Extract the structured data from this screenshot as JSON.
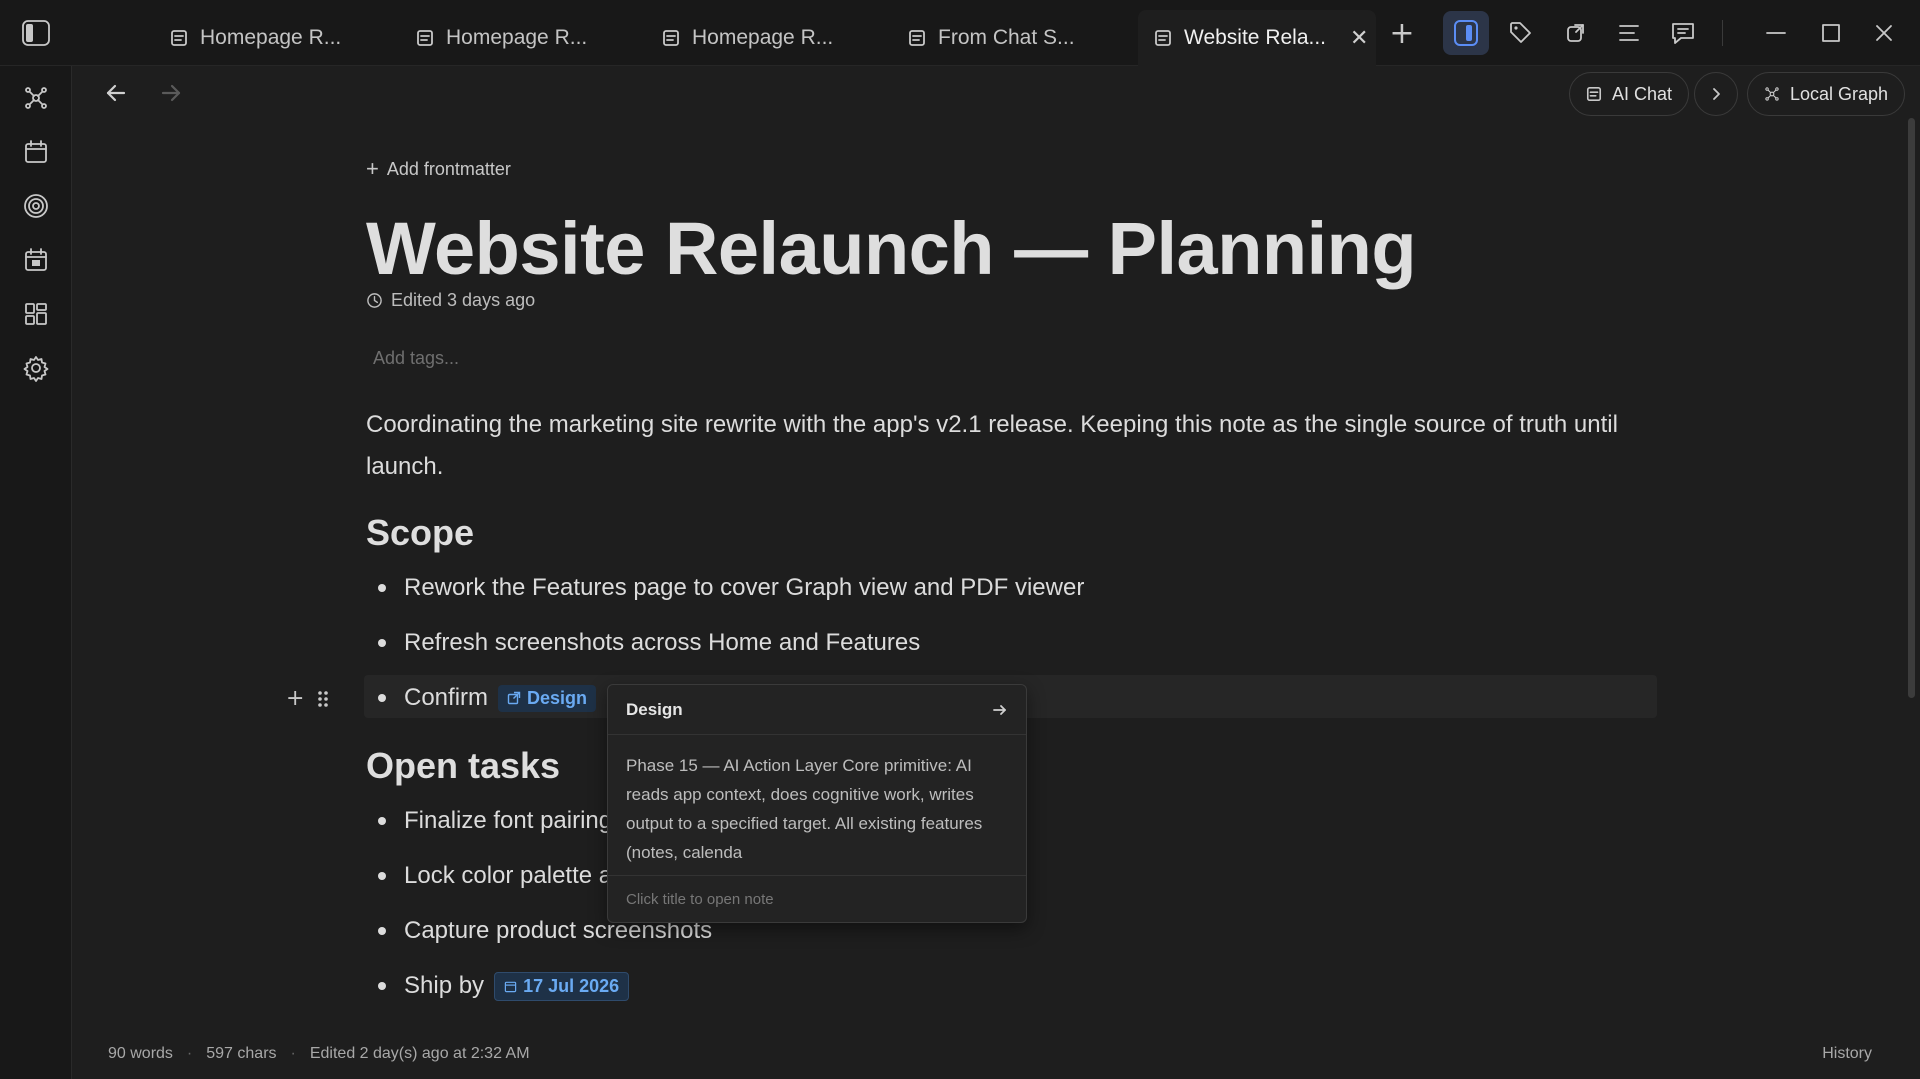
{
  "tabs": [
    {
      "label": "Homepage R...",
      "active": false
    },
    {
      "label": "Homepage R...",
      "active": false
    },
    {
      "label": "Homepage R...",
      "active": false
    },
    {
      "label": "From Chat S...",
      "active": false
    },
    {
      "label": "Website Rela...",
      "active": true
    }
  ],
  "toolbar": {
    "new_tab": "+",
    "icons": [
      "sidebar-toggle-icon",
      "tag-icon",
      "share-icon",
      "outline-icon",
      "comments-icon"
    ],
    "window_controls": [
      "minimize-icon",
      "maximize-icon",
      "close-icon"
    ]
  },
  "rail": {
    "icons": [
      "graph-icon",
      "calendar-icon",
      "target-icon",
      "daily-calendar-icon",
      "dashboard-icon",
      "settings-icon"
    ]
  },
  "nav": {
    "ai_chat": "AI Chat",
    "local_graph": "Local Graph"
  },
  "note": {
    "add_frontmatter": "Add frontmatter",
    "title": "Website Relaunch — Planning",
    "edited": "Edited 3 days ago",
    "tags_placeholder": "Add tags...",
    "intro_line1": "Coordinating the marketing site rewrite with the app's v2.1 release. Keeping this note as the single source of truth until",
    "intro_line2": "launch.",
    "scope_heading": "Scope",
    "scope_items": [
      "Rework the Features page to cover Graph view and PDF viewer",
      "Refresh screenshots across Home and Features",
      "Confirm"
    ],
    "design_link": "Design",
    "open_tasks_heading": "Open tasks",
    "tasks": [
      "Finalize font pairing",
      "Lock color palette a",
      "Capture product screenshots",
      "Ship by"
    ],
    "ship_date": "17 Jul 2026"
  },
  "popover": {
    "title": "Design",
    "body": "Phase 15 — AI Action Layer Core primitive: AI reads app context, does cognitive work, writes output to a specified target. All existing features (notes, calenda",
    "footer": "Click title to open note"
  },
  "footer": {
    "words": "90 words",
    "chars": "597 chars",
    "edited": "Edited 2 day(s) ago at 2:32 AM",
    "history": "History"
  },
  "colors": {
    "background": "#1e1e1e",
    "link_chip_bg": "#1e3147",
    "link_chip_text": "#6aaaf2",
    "active_tool": "#2c3548"
  }
}
